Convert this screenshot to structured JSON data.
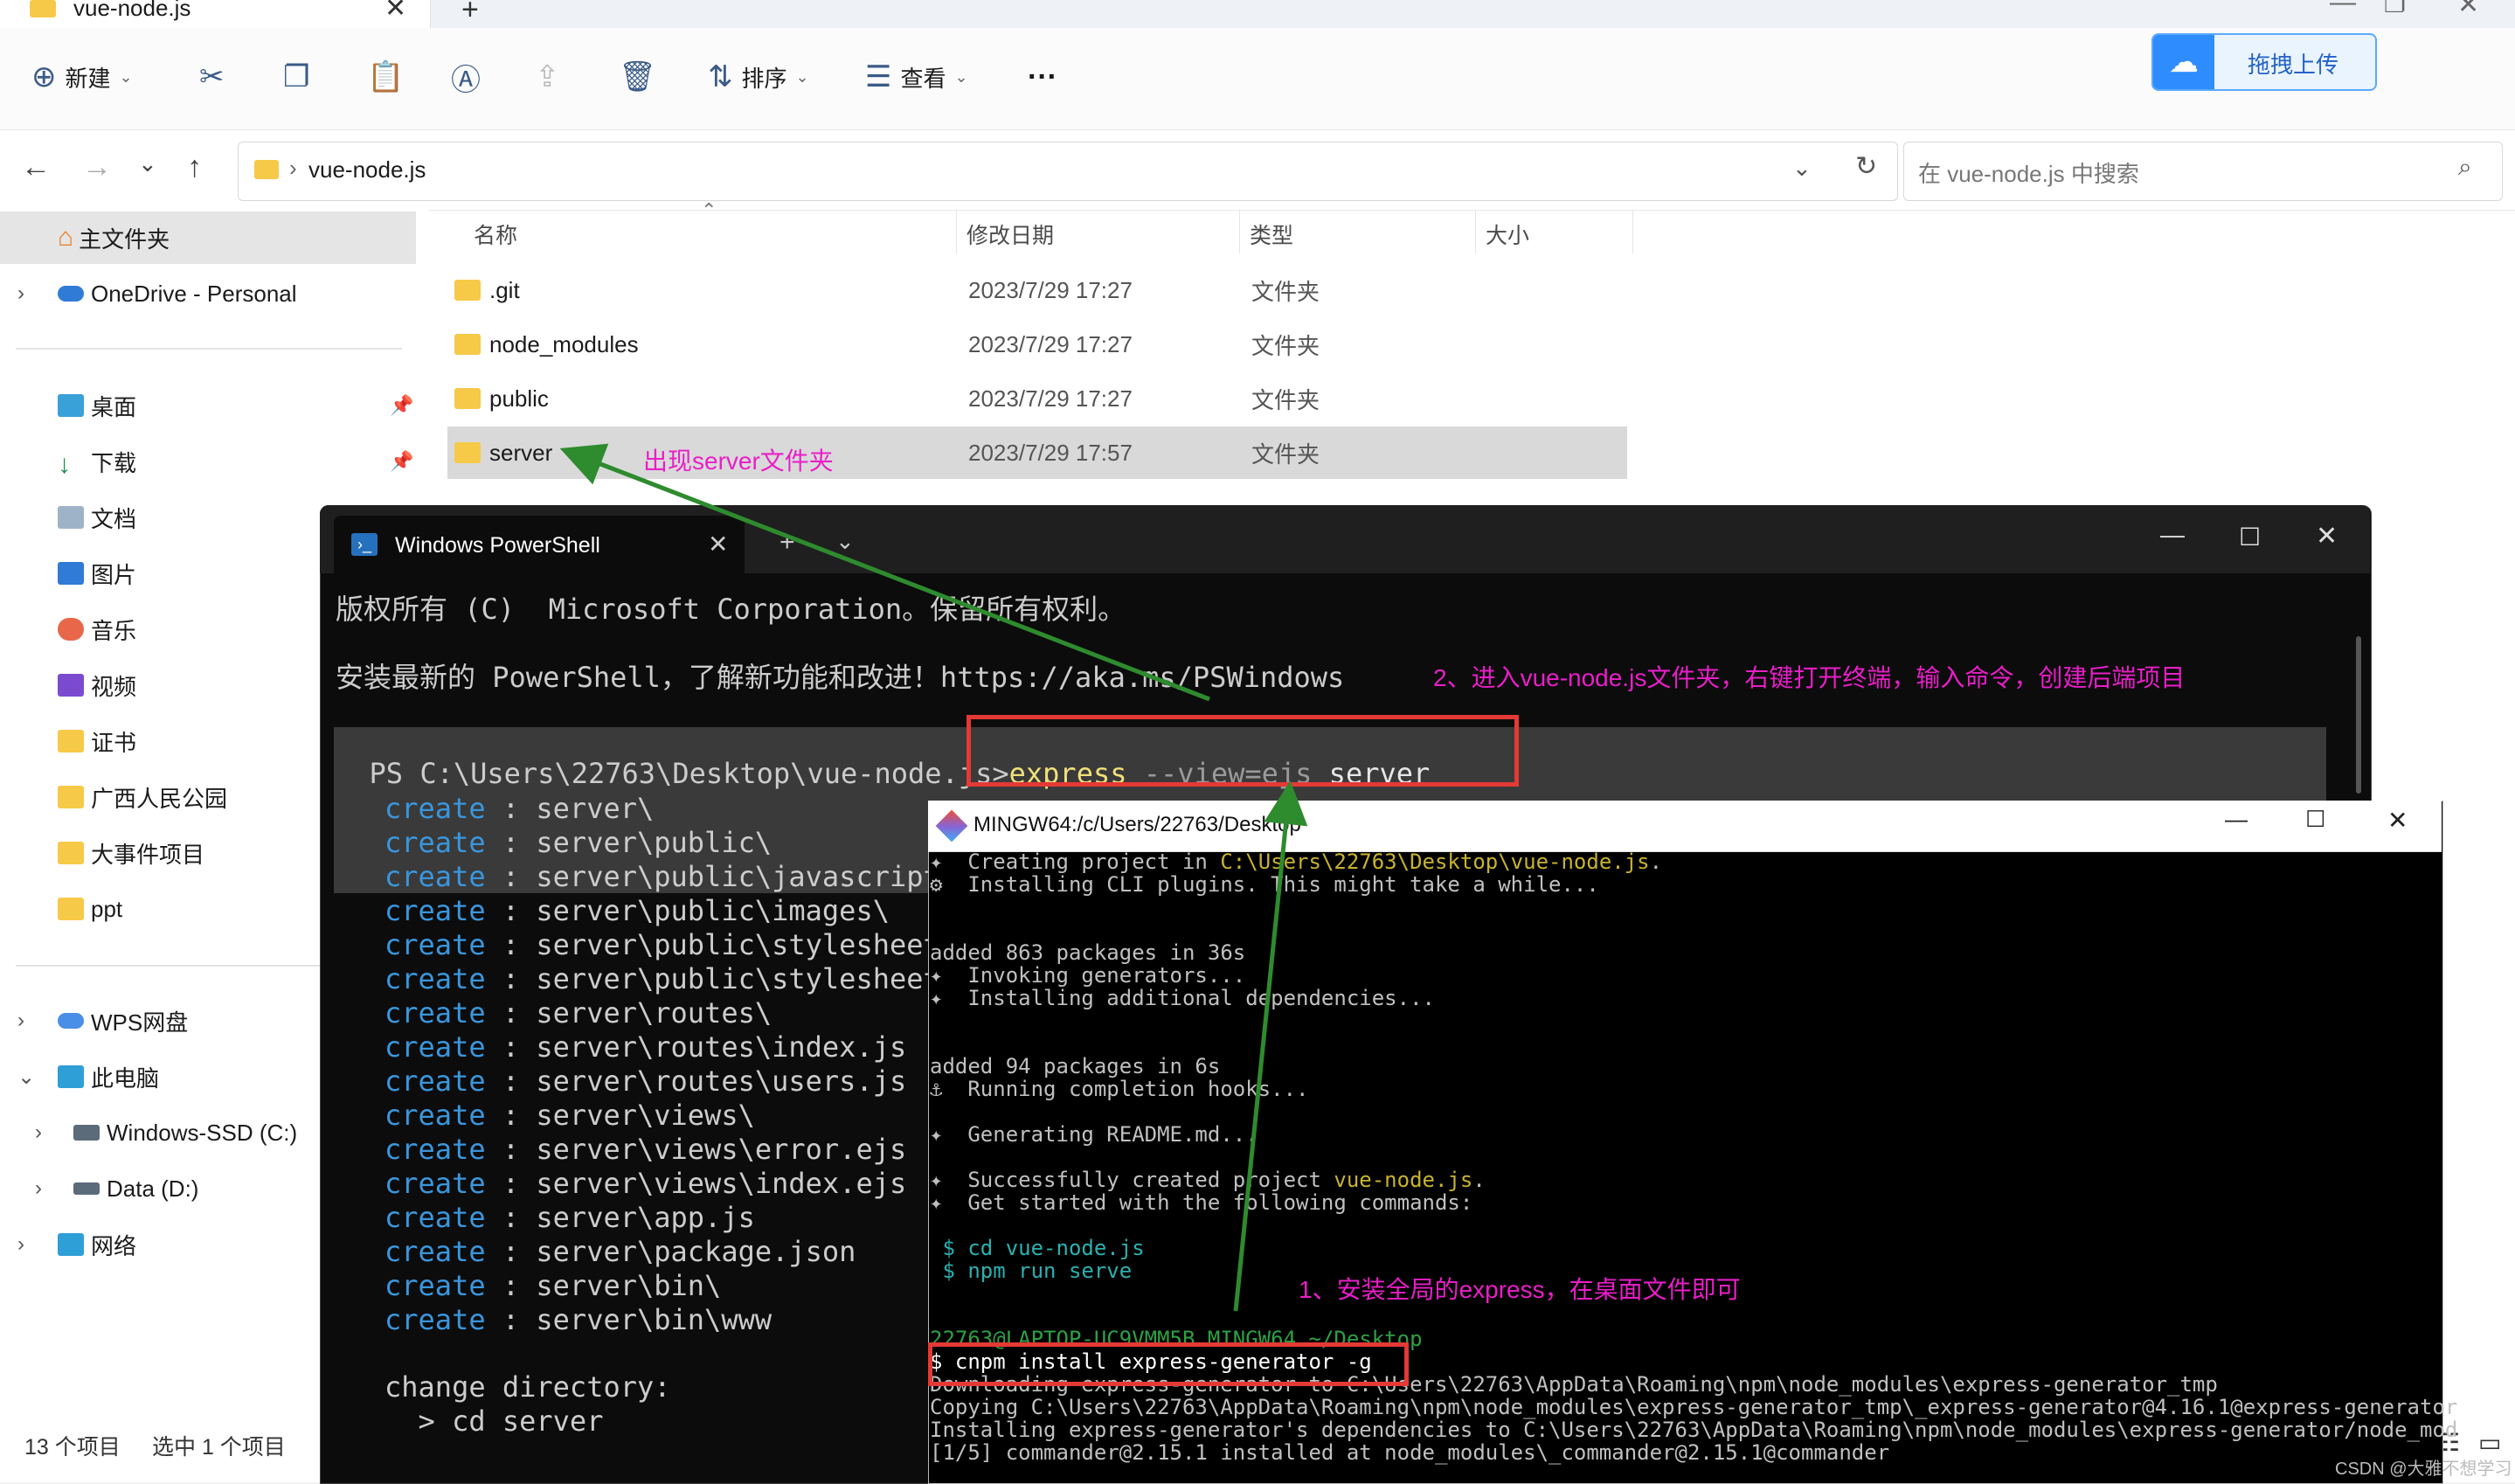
{
  "explorer": {
    "tab_title": "vue-node.js",
    "toolbar": {
      "new_label": "新建",
      "sort_label": "排序",
      "view_label": "查看",
      "more_label": "···",
      "upload_label": "拖拽上传"
    },
    "address": {
      "folder": "vue-node.js"
    },
    "search": {
      "placeholder": "在 vue-node.js 中搜索"
    },
    "sidebar": {
      "items": [
        {
          "label": "主文件夹"
        },
        {
          "label": "OneDrive - Personal"
        },
        {
          "label": "桌面"
        },
        {
          "label": "下载"
        },
        {
          "label": "文档"
        },
        {
          "label": "图片"
        },
        {
          "label": "音乐"
        },
        {
          "label": "视频"
        },
        {
          "label": "证书"
        },
        {
          "label": "广西人民公园"
        },
        {
          "label": "大事件项目"
        },
        {
          "label": "ppt"
        },
        {
          "label": "WPS网盘"
        },
        {
          "label": "此电脑"
        },
        {
          "label": "Windows-SSD (C:)"
        },
        {
          "label": "Data (D:)"
        },
        {
          "label": "网络"
        }
      ]
    },
    "columns": {
      "name": "名称",
      "date": "修改日期",
      "type": "类型",
      "size": "大小"
    },
    "files": [
      {
        "name": ".git",
        "date": "2023/7/29 17:27",
        "type": "文件夹"
      },
      {
        "name": "node_modules",
        "date": "2023/7/29 17:27",
        "type": "文件夹"
      },
      {
        "name": "public",
        "date": "2023/7/29 17:27",
        "type": "文件夹"
      },
      {
        "name": "server",
        "date": "2023/7/29 17:57",
        "type": "文件夹"
      }
    ],
    "status": {
      "count": "13 个项目",
      "selected": "选中 1 个项目"
    }
  },
  "powershell": {
    "tab_title": "Windows PowerShell",
    "copyright": "版权所有 (C)  Microsoft Corporation。保留所有权利。",
    "install_tip": "安装最新的 PowerShell，了解新功能和改进！https://aka.ms/PSWindows",
    "prompt": "PS C:\\Users\\22763\\Desktop\\vue-node.js>",
    "command_a": "express",
    "command_b": " --view=ejs",
    "command_c": " server",
    "create_kw": "create",
    "created": [
      ": server\\",
      ": server\\public\\",
      ": server\\public\\javascript",
      ": server\\public\\images\\",
      ": server\\public\\stylesheet",
      ": server\\public\\stylesheet",
      ": server\\routes\\",
      ": server\\routes\\index.js",
      ": server\\routes\\users.js",
      ": server\\views\\",
      ": server\\views\\error.ejs",
      ": server\\views\\index.ejs",
      ": server\\app.js",
      ": server\\package.json",
      ": server\\bin\\",
      ": server\\bin\\www"
    ],
    "change_dir": "change directory:",
    "cd": "  > cd server"
  },
  "mingw": {
    "title": "MINGW64:/c/Users/22763/Desktop",
    "lines": {
      "l1a": "✦  Creating project in ",
      "l1b": "C:\\Users\\22763\\Desktop\\vue-node.js",
      "l2": "⚙  Installing CLI plugins. This might take a while...",
      "l3": "added 863 packages in 36s",
      "l4": "✦  Invoking generators...",
      "l5": "✦  Installing additional dependencies...",
      "l6": "added 94 packages in 6s",
      "l7": "⚓  Running completion hooks...",
      "l8": "✦  Generating README.md...",
      "l9a": "✦  Successfully created project ",
      "l9b": "vue-node.js",
      "l9c": ".",
      "l10": "✦  Get started with the following commands:",
      "l11": " $ cd vue-node.js",
      "l12": " $ npm run serve",
      "l13": "22763@LAPTOP-UC9VMM5B MINGW64 ~/Desktop",
      "l14": "$ cnpm install express-generator -g",
      "l15": "Downloading express-generator to C:\\Users\\22763\\AppData\\Roaming\\npm\\node_modules\\express-generator_tmp",
      "l16": "Copying C:\\Users\\22763\\AppData\\Roaming\\npm\\node_modules\\express-generator_tmp\\_express-generator@4.16.1@express-generator",
      "l17": "Installing express-generator's dependencies to C:\\Users\\22763\\AppData\\Roaming\\npm\\node_modules\\express-generator/node_mod",
      "l18": "[1/5] commander@2.15.1 installed at node_modules\\_commander@2.15.1@commander"
    }
  },
  "annotations": {
    "n1": "1、安装全局的express，在桌面文件即可",
    "n2": "2、进入vue-node.js文件夹，右键打开终端，输入命令，创建后端项目",
    "n3": "出现server文件夹"
  },
  "watermark": "CSDN @大雅不想学习",
  "colors": {
    "annotation": "#e91ec8",
    "redbox": "#e53935",
    "arrow": "#2e8b2e",
    "create": "#3a96dd"
  }
}
